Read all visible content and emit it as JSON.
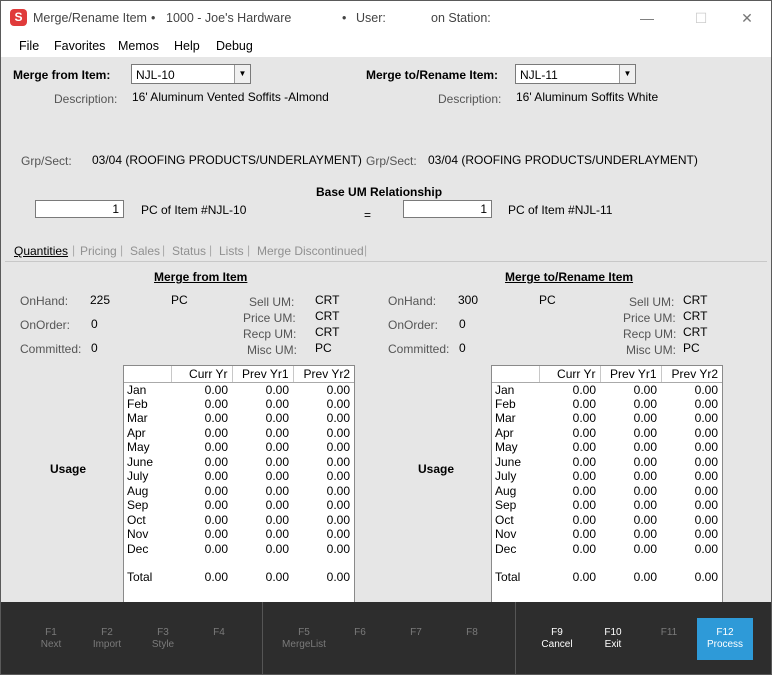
{
  "window": {
    "app_title": "Merge/Rename Item",
    "company": "1000 - Joe's Hardware",
    "user_label": "User:",
    "station_label": "on Station:",
    "title_bullet": "•"
  },
  "menu": [
    "File",
    "Favorites",
    "Memos",
    "Help",
    "Debug"
  ],
  "header": {
    "from_label": "Merge from Item:",
    "from_item": "NJL-10",
    "from_description_label": "Description:",
    "from_description": "16' Aluminum Vented Soffits -Almond",
    "to_label": "Merge to/Rename Item:",
    "to_item": "NJL-11",
    "to_description_label": "Description:",
    "to_description": "16' Aluminum Soffits White",
    "from_grp_label": "Grp/Sect:",
    "from_grp": "03/04 (ROOFING PRODUCTS/UNDERLAYMENT)",
    "to_grp_label": "Grp/Sect:",
    "to_grp": "03/04 (ROOFING PRODUCTS/UNDERLAYMENT)",
    "base_um_title": "Base UM Relationship",
    "from_qty": "1",
    "from_qty_text": "PC of Item #NJL-10",
    "equals": "=",
    "to_qty": "1",
    "to_qty_text": "PC of Item #NJL-11"
  },
  "tabs": [
    {
      "label": "Quantities",
      "active": true
    },
    {
      "label": "Pricing",
      "active": false
    },
    {
      "label": "Sales",
      "active": false
    },
    {
      "label": "Status",
      "active": false
    },
    {
      "label": "Lists",
      "active": false
    },
    {
      "label": "Merge Discontinued",
      "active": false
    }
  ],
  "tab_separator": "|",
  "quantities": {
    "from": {
      "title": "Merge from Item",
      "onhand_label": "OnHand:",
      "onhand": "225",
      "onhand_um": "PC",
      "onorder_label": "OnOrder:",
      "onorder": "0",
      "committed_label": "Committed:",
      "committed": "0",
      "sell_um_label": "Sell UM:",
      "sell_um": "CRT",
      "price_um_label": "Price UM:",
      "price_um": "CRT",
      "recp_um_label": "Recp UM:",
      "recp_um": "CRT",
      "misc_um_label": "Misc UM:",
      "misc_um": "PC",
      "usage_label": "Usage"
    },
    "to": {
      "title": "Merge to/Rename Item",
      "onhand_label": "OnHand:",
      "onhand": "300",
      "onhand_um": "PC",
      "onorder_label": "OnOrder:",
      "onorder": "0",
      "committed_label": "Committed:",
      "committed": "0",
      "sell_um_label": "Sell UM:",
      "sell_um": "CRT",
      "price_um_label": "Price UM:",
      "price_um": "CRT",
      "recp_um_label": "Recp UM:",
      "recp_um": "CRT",
      "misc_um_label": "Misc UM:",
      "misc_um": "PC",
      "usage_label": "Usage"
    },
    "usage_columns": [
      "",
      "Curr Yr",
      "Prev Yr1",
      "Prev Yr2"
    ],
    "from_rows": [
      [
        "Jan",
        "0.00",
        "0.00",
        "0.00"
      ],
      [
        "Feb",
        "0.00",
        "0.00",
        "0.00"
      ],
      [
        "Mar",
        "0.00",
        "0.00",
        "0.00"
      ],
      [
        "Apr",
        "0.00",
        "0.00",
        "0.00"
      ],
      [
        "May",
        "0.00",
        "0.00",
        "0.00"
      ],
      [
        "June",
        "0.00",
        "0.00",
        "0.00"
      ],
      [
        "July",
        "0.00",
        "0.00",
        "0.00"
      ],
      [
        "Aug",
        "0.00",
        "0.00",
        "0.00"
      ],
      [
        "Sep",
        "0.00",
        "0.00",
        "0.00"
      ],
      [
        "Oct",
        "0.00",
        "0.00",
        "0.00"
      ],
      [
        "Nov",
        "0.00",
        "0.00",
        "0.00"
      ],
      [
        "Dec",
        "0.00",
        "0.00",
        "0.00"
      ]
    ],
    "from_total": [
      "Total",
      "0.00",
      "0.00",
      "0.00"
    ],
    "to_rows": [
      [
        "Jan",
        "0.00",
        "0.00",
        "0.00"
      ],
      [
        "Feb",
        "0.00",
        "0.00",
        "0.00"
      ],
      [
        "Mar",
        "0.00",
        "0.00",
        "0.00"
      ],
      [
        "Apr",
        "0.00",
        "0.00",
        "0.00"
      ],
      [
        "May",
        "0.00",
        "0.00",
        "0.00"
      ],
      [
        "June",
        "0.00",
        "0.00",
        "0.00"
      ],
      [
        "July",
        "0.00",
        "0.00",
        "0.00"
      ],
      [
        "Aug",
        "0.00",
        "0.00",
        "0.00"
      ],
      [
        "Sep",
        "0.00",
        "0.00",
        "0.00"
      ],
      [
        "Oct",
        "0.00",
        "0.00",
        "0.00"
      ],
      [
        "Nov",
        "0.00",
        "0.00",
        "0.00"
      ],
      [
        "Dec",
        "0.00",
        "0.00",
        "0.00"
      ]
    ],
    "to_total": [
      "Total",
      "0.00",
      "0.00",
      "0.00"
    ]
  },
  "function_keys": [
    {
      "key": "F1",
      "label": "Next",
      "enabled": false
    },
    {
      "key": "F2",
      "label": "Import",
      "enabled": false
    },
    {
      "key": "F3",
      "label": "Style",
      "enabled": false
    },
    {
      "key": "F4",
      "label": "",
      "enabled": false
    },
    {
      "key": "F5",
      "label": "MergeList",
      "enabled": false
    },
    {
      "key": "F6",
      "label": "",
      "enabled": false
    },
    {
      "key": "F7",
      "label": "",
      "enabled": false
    },
    {
      "key": "F8",
      "label": "",
      "enabled": false
    },
    {
      "key": "F9",
      "label": "Cancel",
      "enabled": true
    },
    {
      "key": "F10",
      "label": "Exit",
      "enabled": true
    },
    {
      "key": "F11",
      "label": "",
      "enabled": false
    },
    {
      "key": "F12",
      "label": "Process",
      "enabled": true,
      "primary": true
    }
  ],
  "colors": {
    "primary_button": "#2e9ad8",
    "function_bar": "#2d2d2d",
    "panel": "#e6e6e6"
  }
}
